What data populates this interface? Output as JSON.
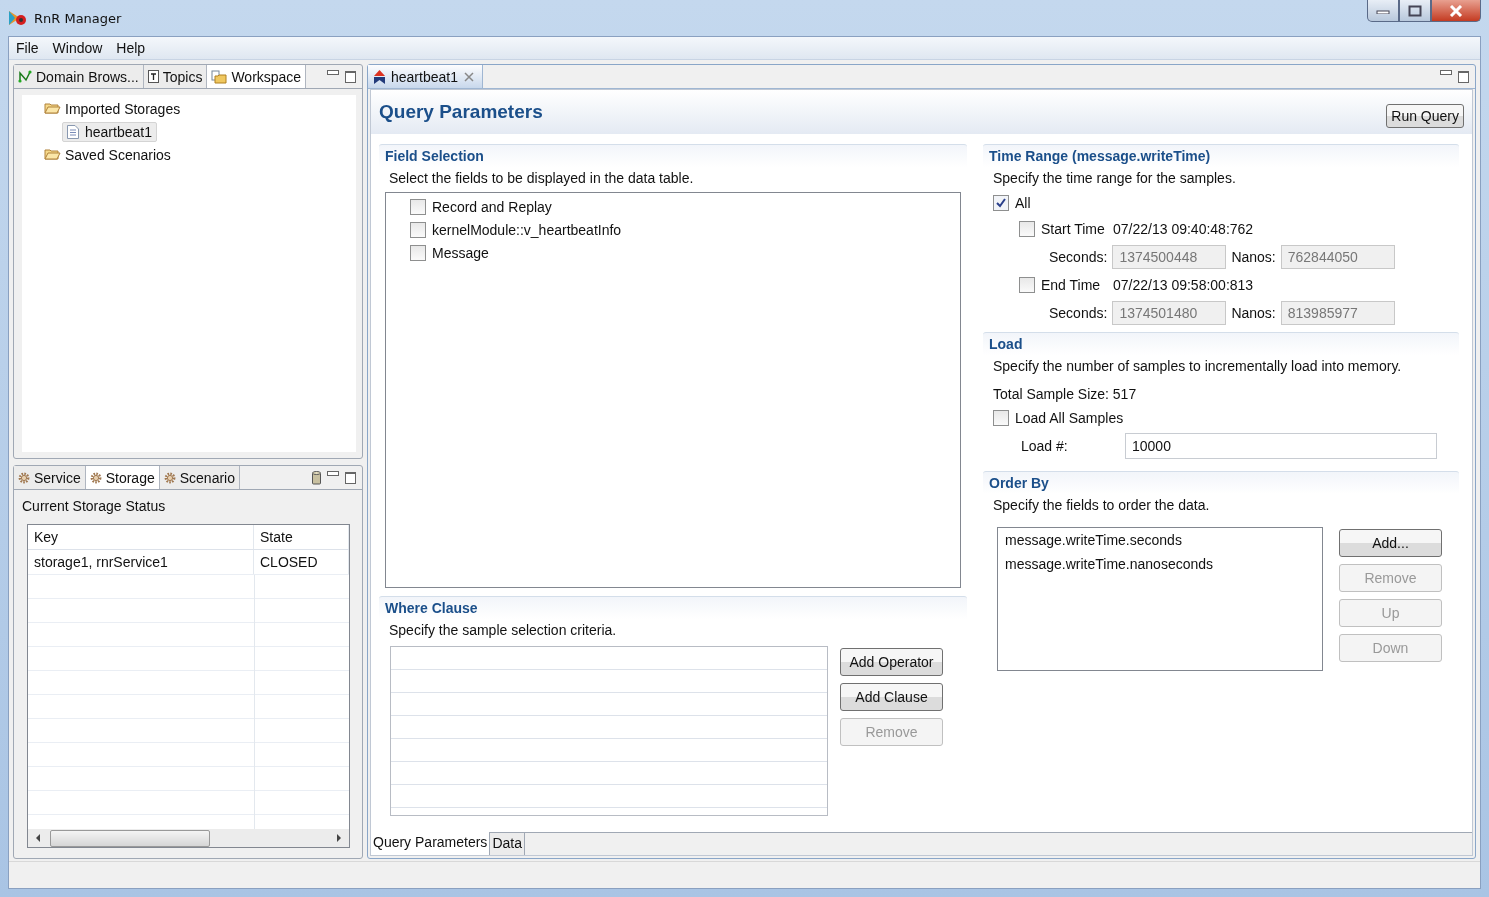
{
  "window": {
    "title": "RnR Manager"
  },
  "menu": [
    "File",
    "Window",
    "Help"
  ],
  "explorer": {
    "tabs": [
      {
        "label": "Domain Brows...",
        "selected": false
      },
      {
        "label": "Topics",
        "selected": false
      },
      {
        "label": "Workspace",
        "selected": true
      }
    ],
    "tree": [
      {
        "label": "Imported Storages",
        "children": [
          {
            "label": "heartbeat1",
            "selected": true
          }
        ]
      },
      {
        "label": "Saved Scenarios"
      }
    ]
  },
  "status_panel": {
    "tabs": [
      {
        "label": "Service",
        "selected": false
      },
      {
        "label": "Storage",
        "selected": true
      },
      {
        "label": "Scenario",
        "selected": false
      }
    ],
    "heading": "Current Storage Status",
    "table": {
      "columns": [
        "Key",
        "State"
      ],
      "rows": [
        [
          "storage1, rnrService1",
          "CLOSED"
        ]
      ]
    }
  },
  "editor": {
    "tab": "heartbeat1",
    "title": "Query Parameters",
    "run_button": "Run Query",
    "field_selection": {
      "title": "Field Selection",
      "description": "Select the fields to be displayed in the data table.",
      "fields": [
        {
          "label": "Record and Replay",
          "checked": false
        },
        {
          "label": "kernelModule::v_heartbeatInfo",
          "checked": false
        },
        {
          "label": "Message",
          "checked": false
        }
      ]
    },
    "where_clause": {
      "title": "Where Clause",
      "description": "Specify the sample selection criteria.",
      "buttons": [
        {
          "label": "Add Operator",
          "disabled": false
        },
        {
          "label": "Add Clause",
          "disabled": false
        },
        {
          "label": "Remove",
          "disabled": true
        }
      ]
    },
    "time_range": {
      "title": "Time Range (message.writeTime)",
      "description": "Specify the time range for the samples.",
      "all": {
        "label": "All",
        "checked": true
      },
      "bounds": [
        {
          "label": "Start Time",
          "checked": false,
          "value": "07/22/13 09:40:48:762",
          "seconds_label": "Seconds:",
          "seconds": "1374500448",
          "nanos_label": "Nanos:",
          "nanos": "762844050"
        },
        {
          "label": "End Time",
          "checked": false,
          "value": "07/22/13 09:58:00:813",
          "seconds_label": "Seconds:",
          "seconds": "1374501480",
          "nanos_label": "Nanos:",
          "nanos": "813985977"
        }
      ]
    },
    "load": {
      "title": "Load",
      "description": "Specify the number of samples to incrementally load into memory.",
      "total": "Total Sample Size: 517",
      "load_all": {
        "label": "Load All Samples",
        "checked": false
      },
      "load_label": "Load #:",
      "load_value": "10000"
    },
    "order_by": {
      "title": "Order By",
      "description": "Specify the fields to order the data.",
      "items": [
        "message.writeTime.seconds",
        "message.writeTime.nanoseconds"
      ],
      "buttons": [
        {
          "label": "Add...",
          "disabled": false
        },
        {
          "label": "Remove",
          "disabled": true
        },
        {
          "label": "Up",
          "disabled": true
        },
        {
          "label": "Down",
          "disabled": true
        }
      ]
    },
    "bottom_tabs": [
      {
        "label": "Query Parameters",
        "selected": true
      },
      {
        "label": "Data",
        "selected": false
      }
    ]
  }
}
